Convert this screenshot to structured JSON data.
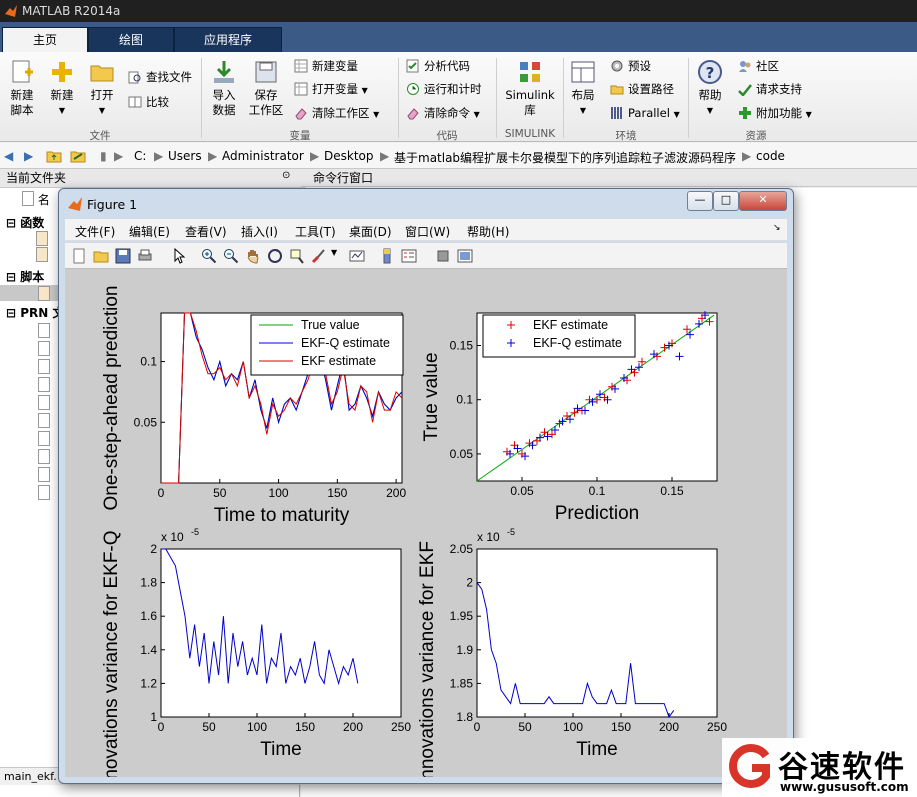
{
  "app": {
    "title": "MATLAB R2014a"
  },
  "tabs": [
    {
      "label": "主页"
    },
    {
      "label": "绘图"
    },
    {
      "label": "应用程序"
    }
  ],
  "ribbon": {
    "new_script": "新建\n脚本",
    "new": "新建",
    "open": "打开",
    "find_files": "查找文件",
    "compare": "比较",
    "import_data": "导入\n数据",
    "save_workspace": "保存\n工作区",
    "new_variable": "新建变量",
    "open_variable": "打开变量",
    "clear_workspace": "清除工作区",
    "analyze_code": "分析代码",
    "run_and_time": "运行和计时",
    "clear_commands": "清除命令",
    "simulink_library": "Simulink\n库",
    "layout": "布局",
    "preferences": "预设",
    "set_path": "设置路径",
    "parallel": "Parallel",
    "help": "帮助",
    "community": "社区",
    "request_support": "请求支持",
    "add_ons": "附加功能",
    "groups": [
      "文件",
      "变量",
      "代码",
      "SIMULINK",
      "环境",
      "资源"
    ]
  },
  "address": {
    "parts": [
      "C:",
      "Users",
      "Administrator",
      "Desktop",
      "基于matlab编程扩展卡尔曼模型下的序列追踪粒子滤波源码程序",
      "code"
    ]
  },
  "left_panel": {
    "header": "当前文件夹",
    "col_name": "名",
    "sections": [
      "函数",
      "脚本",
      "PRN 文"
    ],
    "status": "main_ekf."
  },
  "command_window": {
    "header": "命令行窗口"
  },
  "figure": {
    "title": "Figure 1",
    "menu": [
      "文件(F)",
      "编辑(E)",
      "查看(V)",
      "插入(I)",
      "工具(T)",
      "桌面(D)",
      "窗口(W)",
      "帮助(H)"
    ]
  },
  "chart_data": [
    {
      "type": "line",
      "xlabel": "Time to maturity",
      "ylabel": "One-step-ahead prediction",
      "xlim": [
        0,
        205
      ],
      "ylim": [
        0.0,
        0.14
      ],
      "xticks": [
        0,
        50,
        100,
        150,
        200
      ],
      "yticks": [
        0.05,
        0.1
      ],
      "legend": [
        "True value",
        "EKF-Q estimate",
        "EKF estimate"
      ],
      "legend_position": "top-right",
      "x": [
        0,
        5,
        10,
        15,
        20,
        25,
        30,
        35,
        40,
        45,
        50,
        55,
        60,
        65,
        70,
        75,
        80,
        85,
        90,
        95,
        100,
        105,
        110,
        115,
        120,
        125,
        130,
        135,
        140,
        145,
        150,
        155,
        160,
        165,
        170,
        175,
        180,
        185,
        190,
        195,
        200,
        205
      ],
      "series": [
        {
          "name": "True value",
          "color": "#00aa00",
          "values": [
            0,
            0,
            0,
            0,
            0.14,
            0.14,
            0.12,
            0.11,
            0.095,
            0.085,
            0.1,
            0.08,
            0.09,
            0.085,
            0.1,
            0.07,
            0.085,
            0.06,
            0.045,
            0.07,
            0.05,
            0.065,
            0.07,
            0.06,
            0.075,
            0.09,
            0.1,
            0.105,
            0.085,
            0.06,
            0.08,
            0.1,
            0.06,
            0.065,
            0.08,
            0.07,
            0.055,
            0.075,
            0.065,
            0.06,
            0.07,
            0.075
          ]
        },
        {
          "name": "EKF-Q estimate",
          "color": "#0000dd",
          "values": [
            0,
            0,
            0,
            0,
            0.14,
            0.14,
            0.12,
            0.11,
            0.095,
            0.085,
            0.1,
            0.08,
            0.09,
            0.085,
            0.1,
            0.07,
            0.085,
            0.06,
            0.045,
            0.07,
            0.05,
            0.065,
            0.07,
            0.06,
            0.075,
            0.09,
            0.1,
            0.105,
            0.085,
            0.06,
            0.08,
            0.1,
            0.06,
            0.065,
            0.08,
            0.07,
            0.055,
            0.075,
            0.065,
            0.06,
            0.07,
            0.075
          ]
        },
        {
          "name": "EKF estimate",
          "color": "#dd0000",
          "values": [
            0,
            0,
            0,
            0,
            0.14,
            0.14,
            0.125,
            0.105,
            0.09,
            0.09,
            0.095,
            0.085,
            0.09,
            0.08,
            0.1,
            0.07,
            0.08,
            0.065,
            0.04,
            0.065,
            0.055,
            0.06,
            0.07,
            0.065,
            0.075,
            0.085,
            0.1,
            0.1,
            0.09,
            0.065,
            0.075,
            0.095,
            0.065,
            0.06,
            0.08,
            0.075,
            0.05,
            0.075,
            0.06,
            0.06,
            0.075,
            0.07
          ]
        }
      ]
    },
    {
      "type": "scatter",
      "xlabel": "Prediction",
      "ylabel": "True value",
      "xlim": [
        0.02,
        0.18
      ],
      "ylim": [
        0.025,
        0.18
      ],
      "xticks": [
        0.05,
        0.1,
        0.15
      ],
      "yticks": [
        0.05,
        0.1,
        0.15
      ],
      "legend": [
        "EKF estimate",
        "EKF-Q estimate"
      ],
      "legend_position": "top-left",
      "series": [
        {
          "name": "EKF estimate",
          "color": "#dd0000",
          "marker": "+",
          "points": [
            [
              0.04,
              0.052
            ],
            [
              0.045,
              0.058
            ],
            [
              0.05,
              0.05
            ],
            [
              0.055,
              0.06
            ],
            [
              0.06,
              0.062
            ],
            [
              0.065,
              0.07
            ],
            [
              0.07,
              0.068
            ],
            [
              0.075,
              0.078
            ],
            [
              0.08,
              0.085
            ],
            [
              0.085,
              0.088
            ],
            [
              0.09,
              0.09
            ],
            [
              0.095,
              0.1
            ],
            [
              0.1,
              0.1
            ],
            [
              0.105,
              0.102
            ],
            [
              0.11,
              0.112
            ],
            [
              0.12,
              0.118
            ],
            [
              0.125,
              0.125
            ],
            [
              0.13,
              0.135
            ],
            [
              0.14,
              0.14
            ],
            [
              0.145,
              0.148
            ],
            [
              0.15,
              0.152
            ],
            [
              0.16,
              0.165
            ],
            [
              0.17,
              0.175
            ],
            [
              0.175,
              0.172
            ]
          ]
        },
        {
          "name": "EKF-Q estimate",
          "color": "#0000dd",
          "marker": "+",
          "points": [
            [
              0.042,
              0.05
            ],
            [
              0.047,
              0.055
            ],
            [
              0.052,
              0.048
            ],
            [
              0.057,
              0.058
            ],
            [
              0.062,
              0.065
            ],
            [
              0.067,
              0.066
            ],
            [
              0.072,
              0.072
            ],
            [
              0.077,
              0.08
            ],
            [
              0.082,
              0.082
            ],
            [
              0.087,
              0.092
            ],
            [
              0.092,
              0.09
            ],
            [
              0.097,
              0.098
            ],
            [
              0.102,
              0.105
            ],
            [
              0.107,
              0.1
            ],
            [
              0.112,
              0.11
            ],
            [
              0.118,
              0.12
            ],
            [
              0.123,
              0.128
            ],
            [
              0.128,
              0.13
            ],
            [
              0.138,
              0.142
            ],
            [
              0.148,
              0.15
            ],
            [
              0.155,
              0.14
            ],
            [
              0.162,
              0.16
            ],
            [
              0.168,
              0.17
            ],
            [
              0.172,
              0.178
            ]
          ]
        }
      ],
      "diagonal_color": "#00aa00"
    },
    {
      "type": "line",
      "xlabel": "Time",
      "ylabel": "Innovations variance for EKF-Q",
      "exponent_label": "x 10",
      "exponent_power": "-5",
      "xlim": [
        0,
        250
      ],
      "ylim": [
        1,
        2
      ],
      "xticks": [
        0,
        50,
        100,
        150,
        200,
        250
      ],
      "yticks": [
        1,
        1.2,
        1.4,
        1.6,
        1.8,
        2
      ],
      "x": [
        0,
        5,
        10,
        15,
        20,
        25,
        30,
        35,
        40,
        45,
        50,
        55,
        60,
        65,
        70,
        75,
        80,
        85,
        90,
        95,
        100,
        105,
        110,
        115,
        120,
        125,
        130,
        135,
        140,
        145,
        150,
        155,
        160,
        165,
        170,
        175,
        180,
        185,
        190,
        195,
        200,
        205
      ],
      "series": [
        {
          "color": "#0000cc",
          "values": [
            2.0,
            2.0,
            1.95,
            1.9,
            1.75,
            1.6,
            1.35,
            1.55,
            1.3,
            1.5,
            1.2,
            1.45,
            1.25,
            1.6,
            1.2,
            1.5,
            1.3,
            1.45,
            1.25,
            1.35,
            1.25,
            1.55,
            1.2,
            1.35,
            1.3,
            1.5,
            1.2,
            1.3,
            1.25,
            1.35,
            1.2,
            1.3,
            1.45,
            1.25,
            1.2,
            1.4,
            1.3,
            1.2,
            1.3,
            1.25,
            1.35,
            1.2
          ]
        }
      ]
    },
    {
      "type": "line",
      "xlabel": "Time",
      "ylabel": "Innovations variance for EKF",
      "exponent_label": "x 10",
      "exponent_power": "-5",
      "xlim": [
        0,
        250
      ],
      "ylim": [
        1.8,
        2.05
      ],
      "xticks": [
        0,
        50,
        100,
        150,
        200,
        250
      ],
      "yticks": [
        1.8,
        1.85,
        1.9,
        1.95,
        2,
        2.05
      ],
      "x": [
        0,
        5,
        10,
        15,
        20,
        25,
        30,
        35,
        40,
        45,
        50,
        55,
        60,
        65,
        70,
        75,
        80,
        85,
        90,
        95,
        100,
        105,
        110,
        115,
        120,
        125,
        130,
        135,
        140,
        145,
        150,
        155,
        160,
        165,
        170,
        175,
        180,
        185,
        190,
        195,
        200,
        205
      ],
      "series": [
        {
          "color": "#0000cc",
          "values": [
            2.0,
            1.99,
            1.96,
            1.9,
            1.88,
            1.84,
            1.83,
            1.82,
            1.85,
            1.82,
            1.82,
            1.82,
            1.82,
            1.82,
            1.82,
            1.83,
            1.82,
            1.82,
            1.82,
            1.82,
            1.82,
            1.82,
            1.82,
            1.85,
            1.83,
            1.82,
            1.82,
            1.82,
            1.84,
            1.82,
            1.82,
            1.82,
            1.88,
            1.82,
            1.82,
            1.82,
            1.82,
            1.82,
            1.82,
            1.82,
            1.8,
            1.81
          ]
        }
      ]
    }
  ],
  "watermark": {
    "name": "谷速软件",
    "url": "www.gususoft.com"
  },
  "colors": {
    "ribbon_tab": "#3c5a86",
    "figure_bg": "#cccccc"
  }
}
